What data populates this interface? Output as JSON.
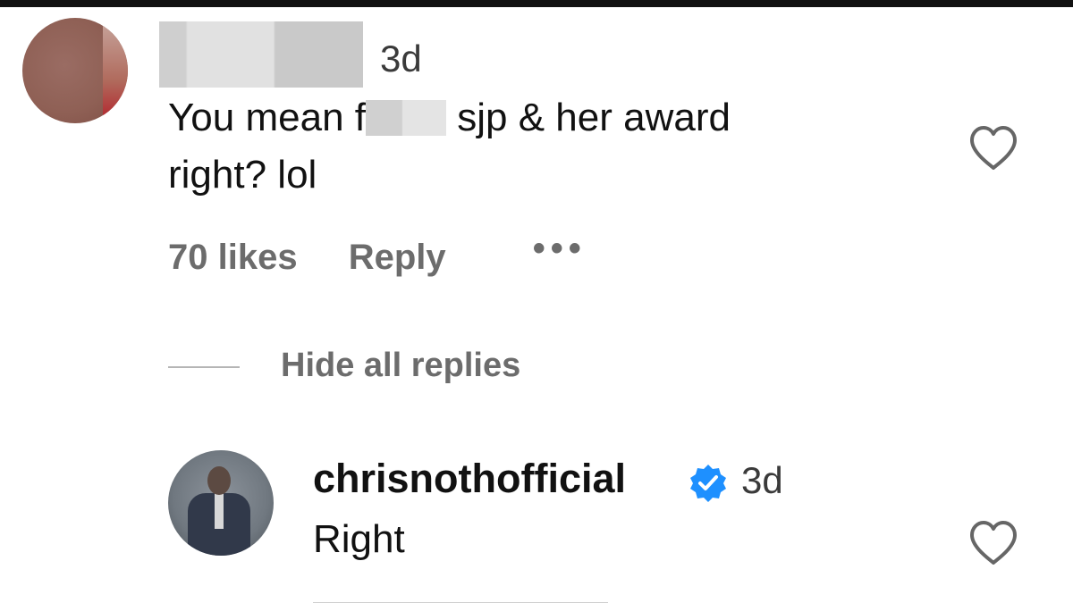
{
  "comments": [
    {
      "timestamp": "3d",
      "text_line_1_before": "You mean f",
      "text_line_1_after": "sjp & her award",
      "text_line_2": "right? lol",
      "likes": "70 likes",
      "reply_label": "Reply",
      "more_label": "•••"
    }
  ],
  "replies_toggle": {
    "label": "Hide all replies"
  },
  "replies": [
    {
      "username": "chrisnothofficial",
      "verified": true,
      "timestamp": "3d",
      "text": "Right"
    }
  ],
  "icons": {
    "like": "heart-outline-icon",
    "verified": "verified-badge-icon",
    "more": "ellipsis-icon"
  },
  "colors": {
    "verified_blue": "#1e90ff",
    "meta_gray": "#6c6c6c",
    "text_dark": "#111111"
  }
}
